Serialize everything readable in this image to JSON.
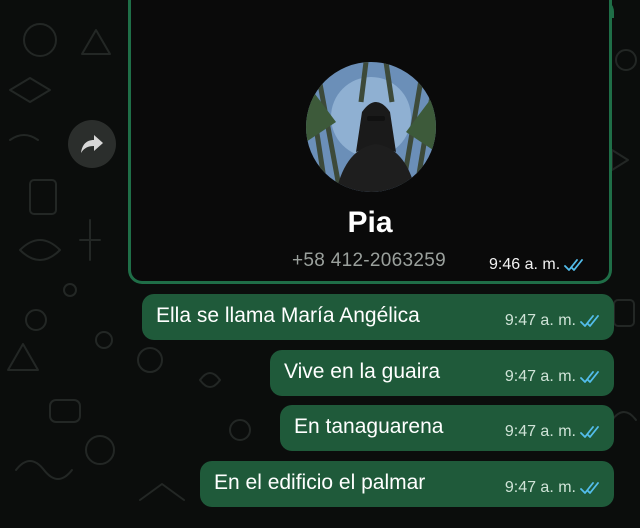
{
  "chat": {
    "contact_card": {
      "name": "Pia",
      "phone": "+58 412-2063259",
      "time": "9:46 a. m."
    },
    "messages": [
      {
        "text": "Ella se llama María Angélica",
        "time": "9:47 a. m."
      },
      {
        "text": "Vive en la guaira",
        "time": "9:47 a. m."
      },
      {
        "text": "En tanaguarena",
        "time": "9:47 a. m."
      },
      {
        "text": "En el edificio el palmar",
        "time": "9:47 a. m."
      }
    ]
  },
  "colors": {
    "bubble": "#1f5a3a",
    "border": "#1f6e47",
    "read_ticks": "#53bdeb",
    "background": "#0b0d0c"
  },
  "icons": [
    "forward-icon",
    "double-check-icon"
  ]
}
